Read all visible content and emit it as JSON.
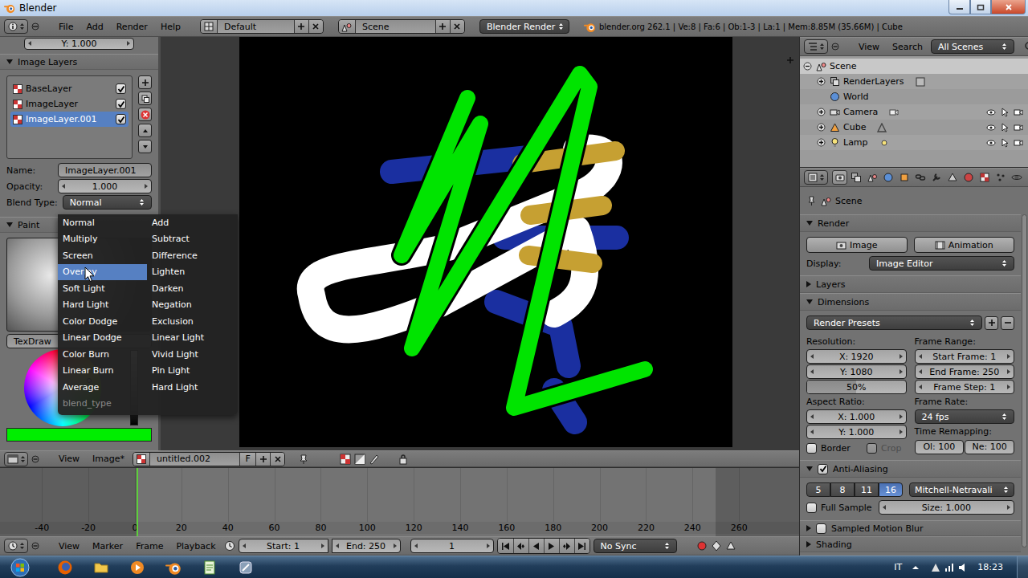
{
  "window": {
    "title": "Blender"
  },
  "info_header": {
    "menus": [
      "File",
      "Add",
      "Render",
      "Help"
    ],
    "layout": "Default",
    "scene": "Scene",
    "engine": "Blender Render",
    "stats": "blender.org 262.1 | Ve:8 | Fa:6 | Ob:1-3 | La:1 | Mem:8.85M (35.66M) | Cube"
  },
  "tool_shelf": {
    "top_field": "Y: 1.000",
    "image_layers": {
      "title": "Image Layers",
      "expanded": true,
      "layers": [
        {
          "name": "BaseLayer",
          "checked": true,
          "selected": false
        },
        {
          "name": "ImageLayer",
          "checked": true,
          "selected": false
        },
        {
          "name": "ImageLayer.001",
          "checked": true,
          "selected": true
        }
      ],
      "name_label": "Name:",
      "name": "ImageLayer.001",
      "opacity_label": "Opacity:",
      "opacity": "1.000",
      "blend_label": "Blend Type:",
      "blend": "Normal"
    },
    "paint": {
      "title": "Paint",
      "expanded": true,
      "brush": "TexDraw",
      "color": "#00ee00"
    }
  },
  "blend_menu": {
    "title": "blend_type",
    "columns": [
      [
        {
          "label": "Normal",
          "selected": false
        },
        {
          "label": "Multiply",
          "selected": false
        },
        {
          "label": "Screen",
          "selected": false
        },
        {
          "label": "Overlay",
          "selected": true
        },
        {
          "label": "Soft Light",
          "selected": false
        },
        {
          "label": "Hard Light",
          "selected": false
        },
        {
          "label": "Color Dodge",
          "selected": false
        },
        {
          "label": "Linear Dodge",
          "selected": false
        },
        {
          "label": "Color Burn",
          "selected": false
        },
        {
          "label": "Linear Burn",
          "selected": false
        },
        {
          "label": "Average",
          "selected": false
        }
      ],
      [
        {
          "label": "Add",
          "selected": false
        },
        {
          "label": "Subtract",
          "selected": false
        },
        {
          "label": "Difference",
          "selected": false
        },
        {
          "label": "Lighten",
          "selected": false
        },
        {
          "label": "Darken",
          "selected": false
        },
        {
          "label": "Negation",
          "selected": false
        },
        {
          "label": "Exclusion",
          "selected": false
        },
        {
          "label": "Linear Light",
          "selected": false
        },
        {
          "label": "Vivid Light",
          "selected": false
        },
        {
          "label": "Pin Light",
          "selected": false
        },
        {
          "label": "Hard Light",
          "selected": false
        }
      ]
    ]
  },
  "image_editor": {
    "menus": [
      "View",
      "Image*"
    ],
    "image": "untitled.002",
    "fake_user": "F"
  },
  "timeline": {
    "ruler": [
      "-40",
      "-20",
      "0",
      "20",
      "40",
      "60",
      "80",
      "100",
      "120",
      "140",
      "160",
      "180",
      "200",
      "220",
      "240",
      "260"
    ],
    "menus": [
      "View",
      "Marker",
      "Frame",
      "Playback"
    ],
    "start": "Start: 1",
    "end": "End: 250",
    "current": "1",
    "sync": "No Sync"
  },
  "outliner": {
    "menus": [
      "View",
      "Search"
    ],
    "filter": "All Scenes",
    "tree": [
      {
        "label": "Scene",
        "kind": "scene",
        "expanded": true,
        "selected": true,
        "children": [
          {
            "label": "RenderLayers",
            "kind": "render_layers",
            "expanded": false,
            "selected": false
          },
          {
            "label": "World",
            "kind": "world",
            "selected": false
          },
          {
            "label": "Camera",
            "kind": "camera",
            "expanded": false,
            "selected": false,
            "visible": true,
            "selectable": true,
            "renderable": true
          },
          {
            "label": "Cube",
            "kind": "mesh",
            "expanded": false,
            "selected": false,
            "visible": true,
            "selectable": true,
            "renderable": true
          },
          {
            "label": "Lamp",
            "kind": "lamp",
            "expanded": false,
            "selected": false,
            "visible": true,
            "selectable": true,
            "renderable": true
          }
        ]
      }
    ]
  },
  "properties": {
    "tabs": [
      {
        "selected": true
      },
      {
        "selected": false
      },
      {
        "selected": false
      },
      {
        "selected": false
      },
      {
        "selected": false
      },
      {
        "selected": false
      },
      {
        "selected": false
      },
      {
        "selected": false
      },
      {
        "selected": false
      },
      {
        "selected": false
      },
      {
        "selected": false
      },
      {
        "selected": false
      }
    ],
    "context": "Scene",
    "render": {
      "title": "Render",
      "expanded": true,
      "buttons": [
        "Image",
        "Animation"
      ],
      "display_label": "Display:",
      "display": "Image Editor"
    },
    "layers": {
      "title": "Layers",
      "expanded": false
    },
    "dimensions": {
      "title": "Dimensions",
      "expanded": true,
      "presets": "Render Presets",
      "resolution_label": "Resolution:",
      "resolution_x": "X: 1920",
      "resolution_y": "Y: 1080",
      "resolution_pct": "50%",
      "pct_level": 0.5,
      "aspect_label": "Aspect Ratio:",
      "aspect_x": "X: 1.000",
      "aspect_y": "Y: 1.000",
      "border": {
        "label": "Border",
        "checked": false,
        "disabled": false
      },
      "crop": {
        "label": "Crop",
        "checked": false,
        "disabled": true
      },
      "frame_range_label": "Frame Range:",
      "start": "Start Frame: 1",
      "end": "End Frame: 250",
      "step": "Frame Step: 1",
      "frame_rate_label": "Frame Rate:",
      "frame_rate": "24 fps",
      "time_remap_label": "Time Remapping:",
      "old": "Ol: 100",
      "new": "Ne: 100"
    },
    "anti_aliasing": {
      "title": "Anti-Aliasing",
      "enabled": true,
      "expanded": true,
      "samples": [
        {
          "label": "5",
          "selected": false
        },
        {
          "label": "8",
          "selected": false
        },
        {
          "label": "11",
          "selected": false
        },
        {
          "label": "16",
          "selected": true
        }
      ],
      "filter": "Mitchell-Netravali",
      "full_sample": {
        "label": "Full Sample",
        "checked": false
      },
      "size": "Size: 1.000"
    },
    "motion_blur": {
      "title": "Sampled Motion Blur",
      "enabled": false,
      "expanded": false
    },
    "shading": {
      "title": "Shading",
      "expanded": false
    }
  },
  "taskbar": {
    "language": "IT",
    "time": "18:23"
  }
}
